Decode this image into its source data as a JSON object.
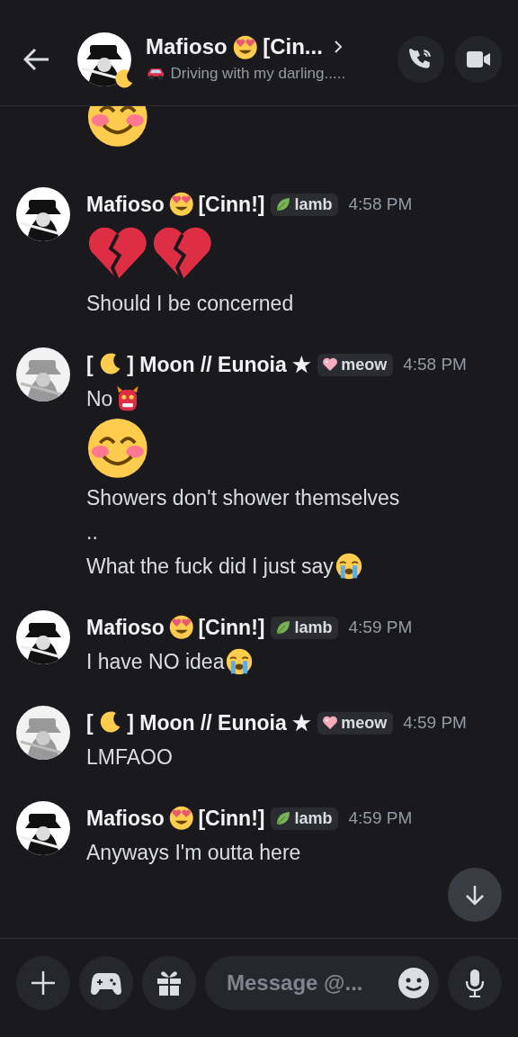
{
  "header": {
    "title_parts": [
      {
        "kind": "text",
        "text": "Mafioso"
      },
      {
        "kind": "heart_eyes"
      },
      {
        "kind": "text",
        "text": "[Cin..."
      }
    ],
    "status_parts": [
      {
        "kind": "car"
      },
      {
        "kind": "text",
        "text": "Driving with my darling....."
      }
    ]
  },
  "messages": [
    {
      "kind": "continuation",
      "lines": [
        [
          {
            "kind": "smile_big"
          }
        ]
      ]
    },
    {
      "kind": "group",
      "author_parts": [
        {
          "kind": "text",
          "text": "Mafioso"
        },
        {
          "kind": "heart_eyes"
        },
        {
          "kind": "text",
          "text": "[Cinn!]"
        }
      ],
      "tag": {
        "kind": "leaf",
        "text": "lamb"
      },
      "time": "4:58 PM",
      "lines": [
        [
          {
            "kind": "broken_heart_big"
          },
          {
            "kind": "broken_heart_big"
          }
        ],
        [
          {
            "kind": "text",
            "text": "Should I be concerned"
          }
        ]
      ]
    },
    {
      "kind": "group",
      "author_parts": [
        {
          "kind": "text",
          "text": "["
        },
        {
          "kind": "moon"
        },
        {
          "kind": "text",
          "text": "] Moon // Eunoia ★"
        }
      ],
      "tag": {
        "kind": "pink_heart",
        "text": "meow"
      },
      "time": "4:58 PM",
      "lines": [
        [
          {
            "kind": "text",
            "text": "No"
          },
          {
            "kind": "ogre"
          }
        ],
        [
          {
            "kind": "smile_big"
          }
        ],
        [
          {
            "kind": "text",
            "text": "Showers don't shower themselves"
          }
        ],
        [
          {
            "kind": "text",
            "text": ".."
          }
        ],
        [
          {
            "kind": "text",
            "text": "What the fuck did I just say"
          },
          {
            "kind": "sob"
          }
        ]
      ]
    },
    {
      "kind": "group",
      "author_parts": [
        {
          "kind": "text",
          "text": "Mafioso"
        },
        {
          "kind": "heart_eyes"
        },
        {
          "kind": "text",
          "text": "[Cinn!]"
        }
      ],
      "tag": {
        "kind": "leaf",
        "text": "lamb"
      },
      "time": "4:59 PM",
      "lines": [
        [
          {
            "kind": "text",
            "text": "I have NO idea"
          },
          {
            "kind": "sob"
          }
        ]
      ]
    },
    {
      "kind": "group",
      "author_parts": [
        {
          "kind": "text",
          "text": "["
        },
        {
          "kind": "moon"
        },
        {
          "kind": "text",
          "text": "] Moon // Eunoia ★"
        }
      ],
      "tag": {
        "kind": "pink_heart",
        "text": "meow"
      },
      "time": "4:59 PM",
      "lines": [
        [
          {
            "kind": "text",
            "text": "LMFAOO"
          }
        ]
      ]
    },
    {
      "kind": "group",
      "author_parts": [
        {
          "kind": "text",
          "text": "Mafioso"
        },
        {
          "kind": "heart_eyes"
        },
        {
          "kind": "text",
          "text": "[Cinn!]"
        }
      ],
      "tag": {
        "kind": "leaf",
        "text": "lamb"
      },
      "time": "4:59 PM",
      "lines": [
        [
          {
            "kind": "text",
            "text": "Anyways I'm outta here"
          }
        ]
      ]
    }
  ],
  "composer": {
    "placeholder": "Message @..."
  }
}
